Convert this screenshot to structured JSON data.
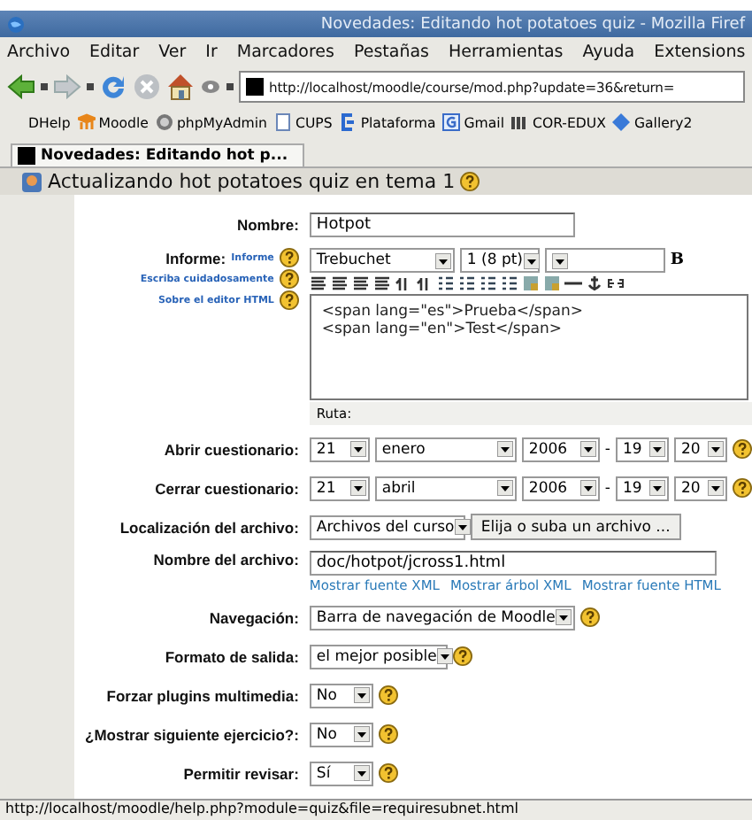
{
  "window": {
    "title": "Novedades: Editando hot potatoes quiz - Mozilla Firef"
  },
  "menu": [
    "Archivo",
    "Editar",
    "Ver",
    "Ir",
    "Marcadores",
    "Pestañas",
    "Herramientas",
    "Ayuda",
    "Extensions"
  ],
  "toolbar": {
    "url": "http://localhost/moodle/course/mod.php?update=36&return="
  },
  "bookmarks": [
    {
      "label": "DHelp",
      "kind": "none"
    },
    {
      "label": "Moodle",
      "kind": "moodle"
    },
    {
      "label": "phpMyAdmin",
      "kind": "globe"
    },
    {
      "label": "CUPS",
      "kind": "page"
    },
    {
      "label": "Plataforma",
      "kind": "bracket"
    },
    {
      "label": "Gmail",
      "kind": "g"
    },
    {
      "label": "COR-EDUX",
      "kind": "bars"
    },
    {
      "label": "Gallery2",
      "kind": "gem"
    }
  ],
  "tabs": [
    {
      "label": "Novedades: Editando hot p...",
      "selected": true
    }
  ],
  "heading": "Actualizando hot potatoes quiz en tema 1",
  "form": {
    "name": {
      "label": "Nombre:",
      "value": "Hotpot"
    },
    "report": {
      "label": "Informe:",
      "links": [
        "Informe",
        "Escriba cuidadosamente",
        "Sobre el editor HTML"
      ],
      "editor": {
        "font": "Trebuchet",
        "size": "1 (8 pt)",
        "bold": "B",
        "lines": [
          "<span lang=\"es\">Prueba</span>",
          "<span lang=\"en\">Test</span>"
        ],
        "path_label": "Ruta:"
      }
    },
    "dates": [
      {
        "label": "Abrir cuestionario:",
        "day": "21",
        "month": "enero",
        "year": "2006",
        "separator": "-",
        "hour": "19",
        "minute": "20"
      },
      {
        "label": "Cerrar cuestionario:",
        "day": "21",
        "month": "abril",
        "year": "2006",
        "separator": "-",
        "hour": "19",
        "minute": "20"
      }
    ],
    "location": {
      "label": "Localización del archivo:",
      "value": "Archivos del curso",
      "button": "Elija o suba un archivo ..."
    },
    "file": {
      "label": "Nombre del archivo:",
      "value": "doc/hotpot/jcross1.html",
      "links": [
        "Mostrar fuente XML",
        "Mostrar árbol XML",
        "Mostrar fuente HTML"
      ]
    },
    "selects": [
      {
        "label": "Navegación:",
        "value": "Barra de navegación de Moodle"
      },
      {
        "label": "Formato de salida:",
        "value": "el mejor posible"
      },
      {
        "label": "Forzar plugins multimedia:",
        "value": "No"
      },
      {
        "label": "¿Mostrar siguiente ejercicio?:",
        "value": "No"
      },
      {
        "label": "Permitir revisar:",
        "value": "Sí"
      }
    ]
  },
  "status_bar": "http://localhost/moodle/help.php?module=quiz&file=requiresubnet.html"
}
